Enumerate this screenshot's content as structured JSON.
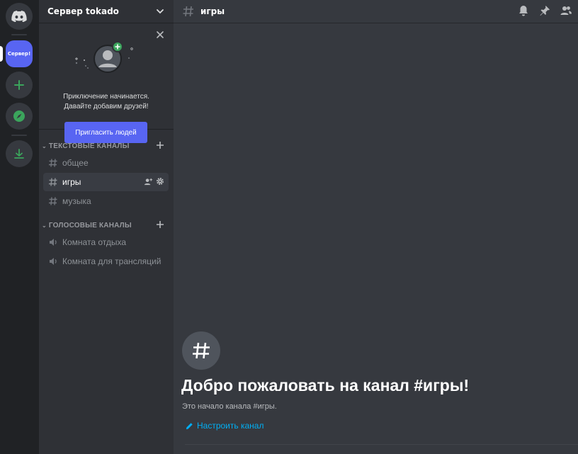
{
  "server": {
    "name": "Сервер tokado",
    "short_name": "Сервер!"
  },
  "invite": {
    "line1": "Приключение начинается.",
    "line2": "Давайте добавим друзей!",
    "button_label": "Пригласить людей"
  },
  "categories": [
    {
      "label": "ТЕКСТОВЫЕ КАНАЛЫ",
      "channels": [
        {
          "name": "общее",
          "icon": "hash-icon"
        },
        {
          "name": "игры",
          "icon": "hash-icon",
          "active": true
        },
        {
          "name": "музыка",
          "icon": "hash-icon"
        }
      ]
    },
    {
      "label": "ГОЛОСОВЫЕ КАНАЛЫ",
      "channels": [
        {
          "name": "Комната отдыха",
          "icon": "speaker-icon"
        },
        {
          "name": "Комната для трансляций",
          "icon": "speaker-icon"
        }
      ]
    }
  ],
  "channel_header": {
    "title": "игры"
  },
  "welcome": {
    "title": "Добро пожаловать на канал #игры!",
    "subtitle": "Это начало канала #игры.",
    "edit_link": "Настроить канал"
  },
  "colors": {
    "accent": "#5865f2",
    "link": "#00aff4",
    "green": "#3ba55c"
  }
}
